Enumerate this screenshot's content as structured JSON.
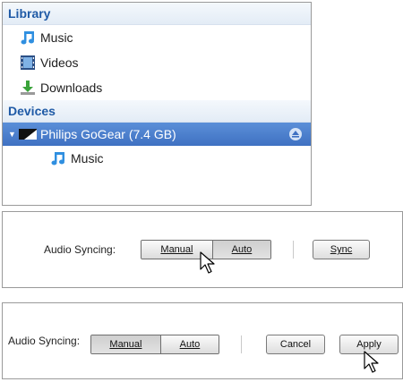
{
  "library": {
    "header": "Library",
    "items": [
      {
        "label": "Music",
        "icon": "music-note-icon"
      },
      {
        "label": "Videos",
        "icon": "film-icon"
      },
      {
        "label": "Downloads",
        "icon": "download-icon"
      }
    ]
  },
  "devices": {
    "header": "Devices",
    "device": {
      "label": "Philips GoGear (7.4 GB)",
      "icon": "device-icon",
      "selected": true
    },
    "children": [
      {
        "label": "Music",
        "icon": "music-note-icon"
      }
    ]
  },
  "sync_panel_1": {
    "label": "Audio Syncing:",
    "options": [
      {
        "label": "Manual",
        "underline": "M",
        "active": false
      },
      {
        "label": "Auto",
        "underline": "A",
        "active": true
      }
    ],
    "sync_button": "Sync"
  },
  "sync_panel_2": {
    "label": "Audio Syncing:",
    "options": [
      {
        "label": "Manual",
        "underline": "M",
        "active": true
      },
      {
        "label": "Auto",
        "underline": "A",
        "active": false
      }
    ],
    "cancel_button": "Cancel",
    "apply_button": "Apply"
  },
  "colors": {
    "header_text": "#1f5aa6",
    "selection": "#3f71c2",
    "music_icon": "#2f8fe0",
    "download_icon": "#3aa33a"
  }
}
